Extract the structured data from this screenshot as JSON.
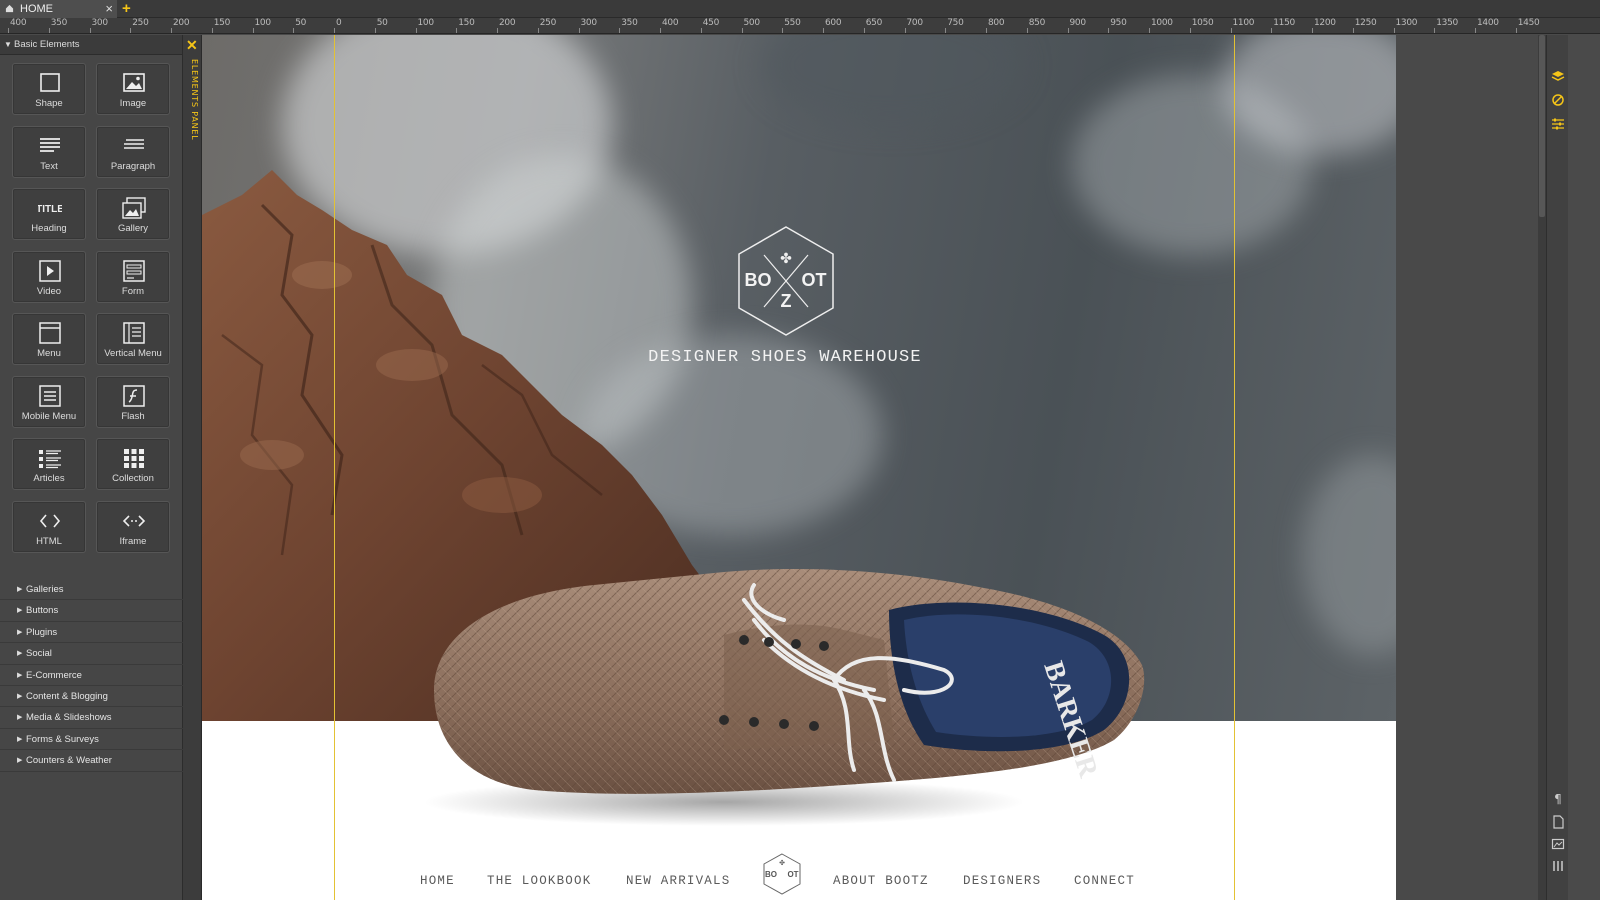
{
  "tabs": [
    {
      "label": "HOME",
      "icon": "home-icon"
    }
  ],
  "add_tab_icon": "+",
  "ruler": {
    "labels": [
      "400",
      "350",
      "300",
      "250",
      "200",
      "150",
      "100",
      "50",
      "0",
      "50",
      "100",
      "150",
      "200",
      "250",
      "300",
      "350",
      "400",
      "450",
      "500",
      "550",
      "600",
      "650",
      "700",
      "750",
      "800",
      "850",
      "900",
      "950",
      "1000",
      "1050",
      "1100",
      "1150",
      "1200",
      "1250",
      "1300",
      "1350",
      "1400",
      "1450"
    ]
  },
  "panel": {
    "section_title": "Basic Elements",
    "elements": [
      {
        "label": "Shape",
        "icon": "shape-icon"
      },
      {
        "label": "Image",
        "icon": "image-icon"
      },
      {
        "label": "Text",
        "icon": "text-icon"
      },
      {
        "label": "Paragraph",
        "icon": "paragraph-icon"
      },
      {
        "label": "Heading",
        "icon": "heading-icon",
        "glyph": "TITLE"
      },
      {
        "label": "Gallery",
        "icon": "gallery-icon"
      },
      {
        "label": "Video",
        "icon": "video-icon"
      },
      {
        "label": "Form",
        "icon": "form-icon"
      },
      {
        "label": "Menu",
        "icon": "menu-icon"
      },
      {
        "label": "Vertical Menu",
        "icon": "vertical-menu-icon"
      },
      {
        "label": "Mobile Menu",
        "icon": "mobile-menu-icon"
      },
      {
        "label": "Flash",
        "icon": "flash-icon"
      },
      {
        "label": "Articles",
        "icon": "articles-icon"
      },
      {
        "label": "Collection",
        "icon": "collection-icon"
      },
      {
        "label": "HTML",
        "icon": "html-icon"
      },
      {
        "label": "Iframe",
        "icon": "iframe-icon"
      }
    ],
    "categories": [
      "Galleries",
      "Buttons",
      "Plugins",
      "Social",
      "E-Commerce",
      "Content & Blogging",
      "Media & Slideshows",
      "Forms & Surveys",
      "Counters & Weather"
    ],
    "strip_title": "ELEMENTS PANEL"
  },
  "site": {
    "logo_letters": {
      "left": "BO",
      "right": "OT",
      "bottom": "Z"
    },
    "tagline": "DESIGNER SHOES WAREHOUSE",
    "shoe_brand": "BARKER",
    "nav": [
      "HOME",
      "THE LOOKBOOK",
      "NEW ARRIVALS",
      "ABOUT BOOTZ",
      "DESIGNERS",
      "CONNECT"
    ],
    "mini_logo": {
      "left": "BO",
      "right": "OT"
    }
  },
  "colors": {
    "accent": "#f5c518",
    "guide": "#e3c234",
    "panel_bg": "#464646"
  }
}
